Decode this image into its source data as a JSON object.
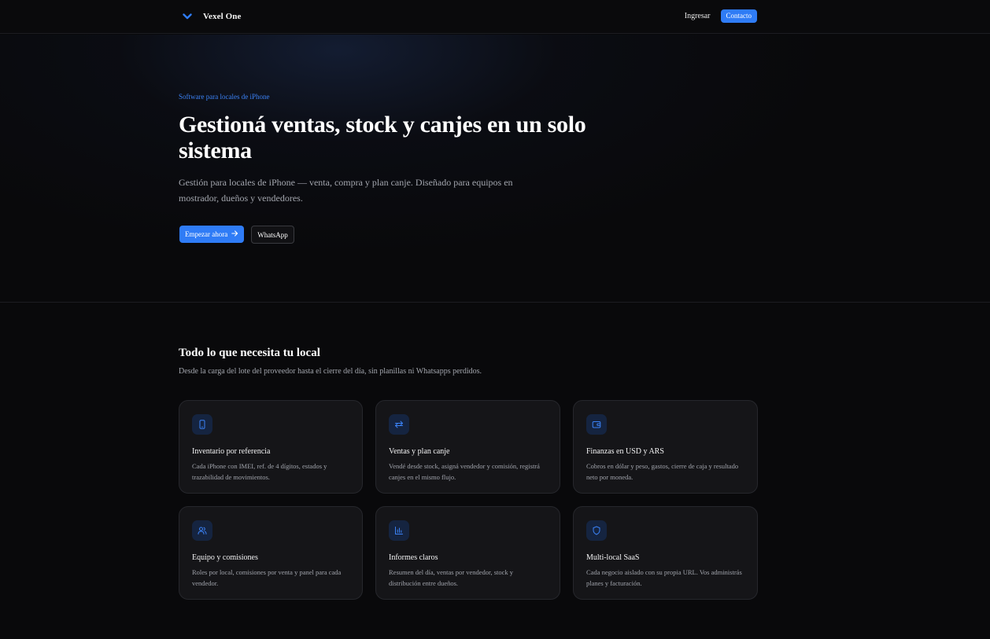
{
  "header": {
    "brand_name": "Vexel One",
    "logo_icon": "chevron-down-icon",
    "login_label": "Ingresar",
    "contact_label": "Contacto"
  },
  "hero": {
    "eyebrow": "Software para locales de iPhone",
    "title": "Gestioná ventas, stock y canjes en un solo sistema",
    "subtitle": "Gestión para locales de iPhone — venta, compra y plan canje. Diseñado para equipos en mostrador, dueños y vendedores.",
    "primary_button": "Empezar ahora",
    "primary_button_icon": "arrow-right-icon",
    "secondary_button": "WhatsApp"
  },
  "features": {
    "title": "Todo lo que necesita tu local",
    "subtitle": "Desde la carga del lote del proveedor hasta el cierre del día, sin planillas ni Whatsapps perdidos.",
    "cards": [
      {
        "icon": "smartphone-icon",
        "title": "Inventario por referencia",
        "description": "Cada iPhone con IMEI, ref. de 4 dígitos, estados y trazabilidad de movimientos."
      },
      {
        "icon": "swap-arrows-icon",
        "title": "Ventas y plan canje",
        "description": "Vendé desde stock, asigná vendedor y comisión, registrá canjes en el mismo flujo."
      },
      {
        "icon": "wallet-icon",
        "title": "Finanzas en USD y ARS",
        "description": "Cobros en dólar y peso, gastos, cierre de caja y resultado neto por moneda."
      },
      {
        "icon": "users-icon",
        "title": "Equipo y comisiones",
        "description": "Roles por local, comisiones por venta y panel para cada vendedor."
      },
      {
        "icon": "bar-chart-icon",
        "title": "Informes claros",
        "description": "Resumen del día, ventas por vendedor, stock y distribución entre dueños."
      },
      {
        "icon": "shield-icon",
        "title": "Multi-local SaaS",
        "description": "Cada negocio aislado con su propia URL. Vos administrás planes y facturación."
      }
    ]
  },
  "colors": {
    "accent": "#2f7cf6",
    "background": "#09090b",
    "card": "#151518"
  }
}
